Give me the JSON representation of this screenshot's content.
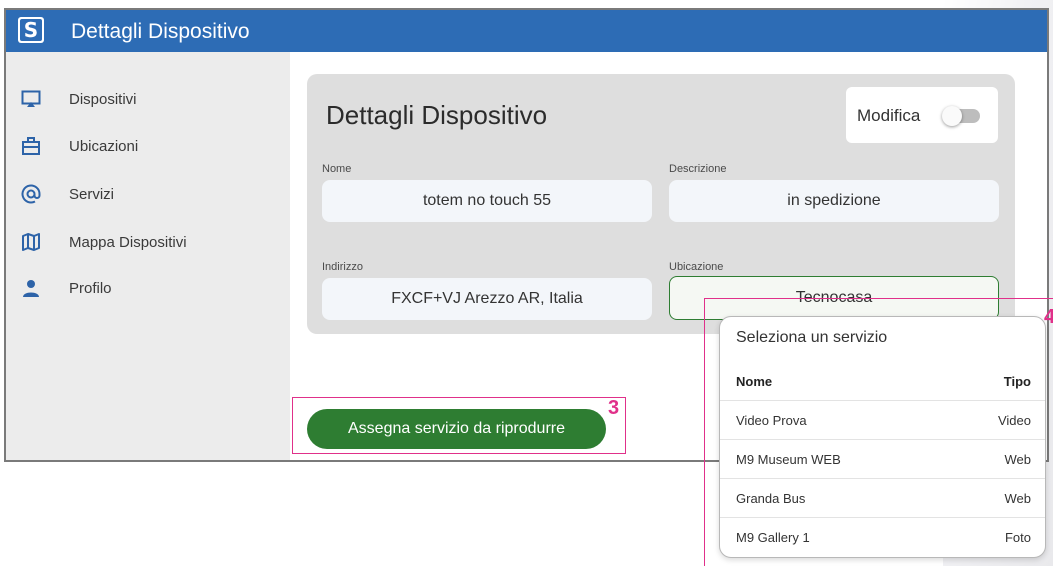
{
  "header": {
    "logo_text": "S",
    "title": "Dettagli Dispositivo"
  },
  "sidebar": {
    "items": [
      {
        "label": "Dispositivi",
        "icon": "monitor-icon"
      },
      {
        "label": "Ubicazioni",
        "icon": "briefcase-icon"
      },
      {
        "label": "Servizi",
        "icon": "at-sign-icon"
      },
      {
        "label": "Mappa Dispositivi",
        "icon": "map-icon"
      },
      {
        "label": "Profilo",
        "icon": "person-icon"
      }
    ]
  },
  "details": {
    "title": "Dettagli Dispositivo",
    "edit_label": "Modifica",
    "edit_enabled": false,
    "fields": {
      "nome": {
        "label": "Nome",
        "value": "totem no touch 55"
      },
      "descrizione": {
        "label": "Descrizione",
        "value": "in spedizione"
      },
      "indirizzo": {
        "label": "Indirizzo",
        "value": "FXCF+VJ Arezzo AR, Italia"
      },
      "ubicazione": {
        "label": "Ubicazione",
        "value": "Tecnocasa"
      }
    }
  },
  "assign_button": {
    "label": "Assegna servizio da riprodurre"
  },
  "callouts": {
    "three": "3",
    "four": "4"
  },
  "service_popup": {
    "title": "Seleziona un servizio",
    "columns": {
      "name": "Nome",
      "type": "Tipo"
    },
    "rows": [
      {
        "name": "Video Prova",
        "type": "Video"
      },
      {
        "name": "M9 Museum WEB",
        "type": "Web"
      },
      {
        "name": "Granda Bus",
        "type": "Web"
      },
      {
        "name": "M9 Gallery 1",
        "type": "Foto"
      }
    ]
  },
  "colors": {
    "header": "#2d6cb5",
    "accent_green": "#2e7d32",
    "callout": "#e0308a",
    "sidebar_bg": "#ececec",
    "card_bg": "#dedede"
  }
}
